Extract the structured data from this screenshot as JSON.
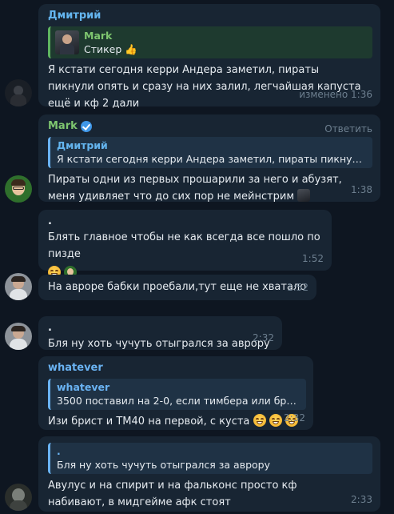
{
  "messages": [
    {
      "sender": "Дмитрий",
      "sender_color": "#64b5ef",
      "reply": {
        "name": "Mark",
        "text": "Стикер",
        "emoji": "👍"
      },
      "text": "Я кстати сегодня керри Андера заметил, пираты пикнули опять и сразу на них залил, легчайшая капуста ещё и кф 2 дали",
      "time": "изменено 1:36"
    },
    {
      "sender": "Mark",
      "sender_color": "#7ec66f",
      "verified_icon": "verified-badge-icon",
      "reply_action": "Ответить",
      "reply": {
        "name": "Дмитрий",
        "text": "Я кстати сегодня керри Андера заметил, пираты пикнули опя..."
      },
      "text": "Пираты одни из первых прошарили за него и абузят, меня удивляет что до сих пор не мейнстрим",
      "time": "1:38"
    },
    {
      "sender": ".",
      "text": "Блять главное чтобы не как всегда все пошло по пизде",
      "time": "1:52"
    },
    {
      "text": "На авроре бабки проебали,тут еще не хватало",
      "time": "1:52"
    },
    {
      "sender": ".",
      "text": "Бля ну хоть чучуть отыгрался за аврору",
      "time": "2:32"
    },
    {
      "sender": "whatever",
      "sender_color": "#6ab3f3",
      "reply": {
        "name": "whatever",
        "text": "3500 поставил на 2-0, если тимбера или бриста ..."
      },
      "text": "Изи брист и ТМ40 на первой, с куста",
      "time": "2:32"
    },
    {
      "reply": {
        "name": ".",
        "text": "Бля ну хоть чучуть отыгрался за аврору"
      },
      "text": "Авулус и на спирит и на фальконс просто кф набивают, в мидгейме афк стоят",
      "time": "2:33"
    }
  ]
}
